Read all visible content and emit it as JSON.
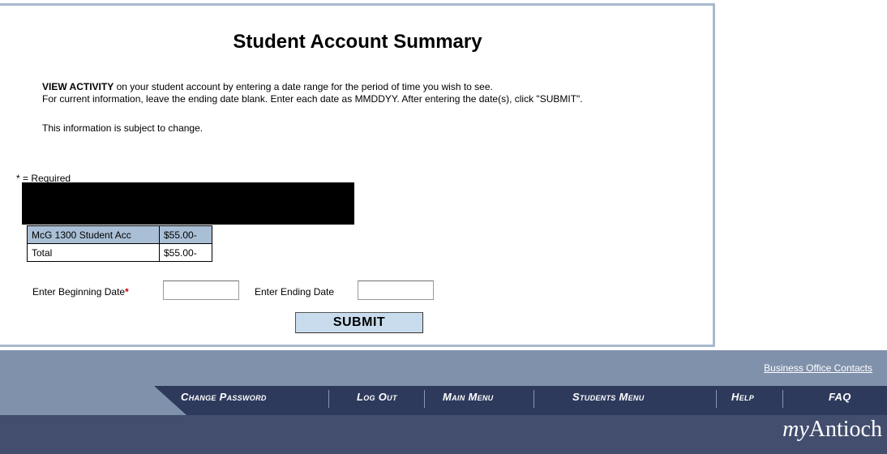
{
  "page": {
    "title": "Student Account Summary",
    "intro_bold": "VIEW ACTIVITY",
    "intro_rest": " on your student account by entering a date range for the period of time you wish to see.",
    "intro_line2": "For current information, leave the ending date blank. Enter each date as MMDDYY. After entering the date(s), click \"SUBMIT\".",
    "notice": "This information is subject to change.",
    "required_note": "* = Required"
  },
  "summary_table": {
    "rows": [
      {
        "label": "McG 1300 Student Acc",
        "amount": "$55.00-"
      },
      {
        "label": "Total",
        "amount": "$55.00-"
      }
    ]
  },
  "form": {
    "begin_label": "Enter Beginning Date",
    "begin_required": "*",
    "begin_value": "",
    "end_label": "Enter Ending Date",
    "end_value": "",
    "submit_label": "SUBMIT"
  },
  "footer": {
    "contacts_link": "Business Office Contacts",
    "nav": [
      "Change Password",
      "Log Out",
      "Main Menu",
      "Students Menu",
      "Help",
      "FAQ"
    ],
    "brand_my": "my",
    "brand_name": "Antioch"
  },
  "colors": {
    "panel_border": "#a9b9cd",
    "table_header": "#a9bfd6",
    "button_bg": "#c9dcee",
    "footer_light": "#8091ab",
    "footer_dark": "#2e3a5c",
    "required_star": "#cc0000"
  }
}
